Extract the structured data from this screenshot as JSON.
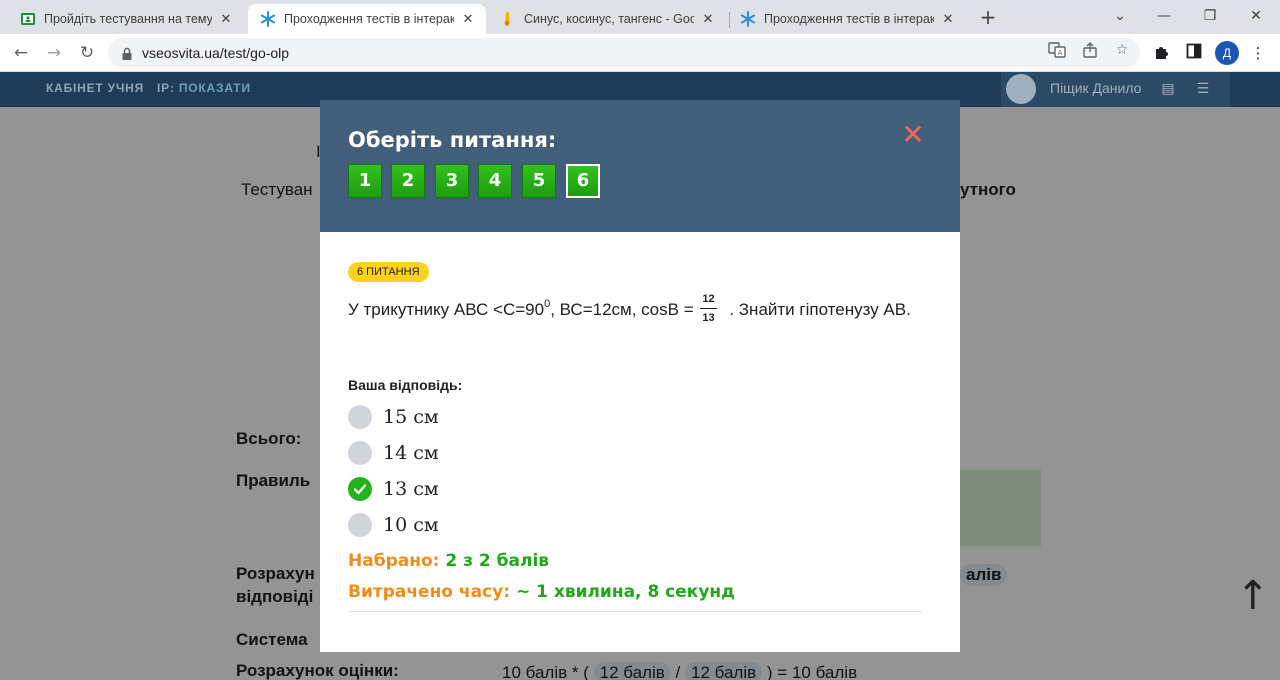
{
  "browser": {
    "tabs": [
      {
        "title": "Пройдіть тестування на тему: Си",
        "favicon": "classroom-icon"
      },
      {
        "title": "Проходження тестів в інтеракти",
        "favicon": "vseosvita-icon"
      },
      {
        "title": "Синус, косинус, тангенс - Googl",
        "favicon": "google-search-icon"
      },
      {
        "title": "Проходження тестів в інтеракти",
        "favicon": "vseosvita-icon"
      }
    ],
    "url": "vseosvita.ua/test/go-olp",
    "profile_initial": "Д"
  },
  "site_header": {
    "cabinet": "КАБІНЕТ УЧНЯ",
    "ip_label": "IP:",
    "ip_value": "ПОКАЗАТИ",
    "user_name": "Піщик Данило"
  },
  "background": {
    "heading_start": "Тестуван",
    "heading_end": "утного",
    "letter": "I",
    "total": "Всього:",
    "correct": "Правиль",
    "calc1": "Розрахун",
    "calc2": "відповіді",
    "points_tail": "алів",
    "system": "Система",
    "grade_calc": "Розрахунок оцінки:",
    "grade_formula_a": "10 балів * (",
    "grade_formula_b": "12 балів",
    "grade_formula_c": "/",
    "grade_formula_d": "12 балів",
    "grade_formula_e": ") = 10 балів"
  },
  "modal": {
    "title": "Оберіть питання:",
    "questions": [
      "1",
      "2",
      "3",
      "4",
      "5",
      "6"
    ],
    "current_question": "6",
    "badge": "6 ПИТАННЯ",
    "question_part1": "У трикутнику АВС <С=90",
    "question_sup": "0",
    "question_part2": ", ВС=12см, cosB =",
    "fraction_num": "12",
    "fraction_den": "13",
    "question_part3": ". Знайти гіпотенузу АВ.",
    "answer_label": "Ваша відповідь:",
    "options": [
      {
        "label": "15 см",
        "selected": false
      },
      {
        "label": "14 см",
        "selected": false
      },
      {
        "label": "13 см",
        "selected": true
      },
      {
        "label": "10 см",
        "selected": false
      }
    ],
    "score_label": "Набрано:",
    "score_value": "2 з 2 балів",
    "time_label": "Витрачено часу:",
    "time_value": "~ 1 хвилина, 8 секунд"
  },
  "colors": {
    "modal_header": "#415e7b",
    "nav_green": "#22b41a",
    "close": "#ef6b56",
    "badge": "#ffd21f",
    "label_orange": "#f08c1a",
    "value_green": "#20a81a"
  }
}
